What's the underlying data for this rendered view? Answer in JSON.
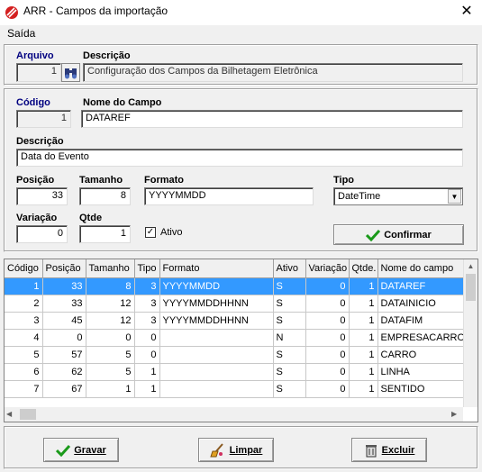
{
  "window": {
    "title": "ARR - Campos da importação",
    "close_glyph": "✕"
  },
  "menu": {
    "items": [
      "Saída"
    ]
  },
  "arquivo": {
    "label": "Arquivo",
    "value": "1",
    "descricao_label": "Descrição",
    "descricao_value": "Configuração dos Campos da Bilhetagem Eletrônica"
  },
  "campo": {
    "codigo_label": "Código",
    "codigo_value": "1",
    "nome_label": "Nome do Campo",
    "nome_value": "DATAREF",
    "descricao_label": "Descrição",
    "descricao_value": "Data do Evento",
    "posicao_label": "Posição",
    "posicao_value": "33",
    "tamanho_label": "Tamanho",
    "tamanho_value": "8",
    "formato_label": "Formato",
    "formato_value": "YYYYMMDD",
    "tipo_label": "Tipo",
    "tipo_value": "DateTime",
    "variacao_label": "Variação",
    "variacao_value": "0",
    "qtde_label": "Qtde",
    "qtde_value": "1",
    "ativo_label": "Ativo",
    "ativo_checked": true,
    "confirmar_label": "Confirmar"
  },
  "grid": {
    "columns": [
      "Código",
      "Posição",
      "Tamanho",
      "Tipo",
      "Formato",
      "Ativo",
      "Variação",
      "Qtde.",
      "Nome do campo"
    ],
    "rows": [
      [
        "1",
        "33",
        "8",
        "3",
        "YYYYMMDD",
        "S",
        "0",
        "1",
        "DATAREF"
      ],
      [
        "2",
        "33",
        "12",
        "3",
        "YYYYMMDDHHNN",
        "S",
        "0",
        "1",
        "DATAINICIO"
      ],
      [
        "3",
        "45",
        "12",
        "3",
        "YYYYMMDDHHNN",
        "S",
        "0",
        "1",
        "DATAFIM"
      ],
      [
        "4",
        "0",
        "0",
        "0",
        "",
        "N",
        "0",
        "1",
        "EMPRESACARRO"
      ],
      [
        "5",
        "57",
        "5",
        "0",
        "",
        "S",
        "0",
        "1",
        "CARRO"
      ],
      [
        "6",
        "62",
        "5",
        "1",
        "",
        "S",
        "0",
        "1",
        "LINHA"
      ],
      [
        "7",
        "67",
        "1",
        "1",
        "",
        "S",
        "0",
        "1",
        "SENTIDO"
      ]
    ],
    "selected_row": 0
  },
  "footer": {
    "gravar_label": "Gravar",
    "limpar_label": "Limpar",
    "excluir_label": "Excluir"
  },
  "colors": {
    "selection": "#3399ff",
    "accent_green": "#1a9a1a",
    "label_navy": "#000080"
  }
}
